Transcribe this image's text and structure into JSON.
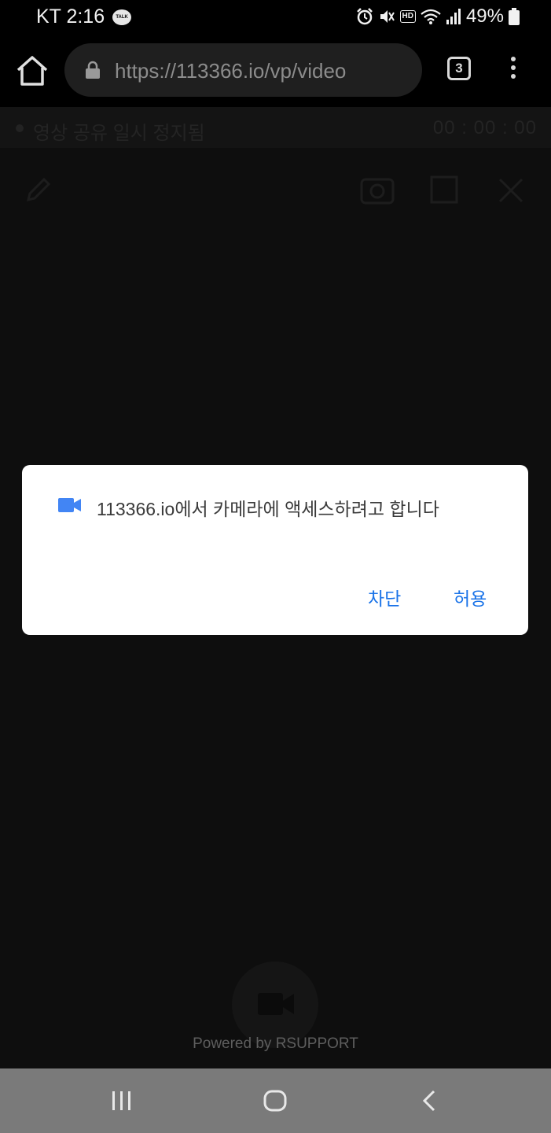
{
  "status_bar": {
    "carrier_time": "KT 2:16",
    "talk_badge": "TALK",
    "hd_badge": "HD",
    "battery": "49%"
  },
  "browser": {
    "url": "https://113366.io/vp/video",
    "tab_count": "3"
  },
  "page": {
    "share_status": "영상 공유 일시 정지됨",
    "timer": "00 : 00 : 00",
    "powered_by": "Powered by RSUPPORT"
  },
  "dialog": {
    "message": "113366.io에서 카메라에 액세스하려고 합니다",
    "block_label": "차단",
    "allow_label": "허용",
    "icon": "video-camera-icon",
    "accent_color": "#1a73e8"
  },
  "nav": {
    "recents_icon": "recents-icon",
    "home_icon": "home-circle-icon",
    "back_icon": "back-chevron-icon"
  }
}
